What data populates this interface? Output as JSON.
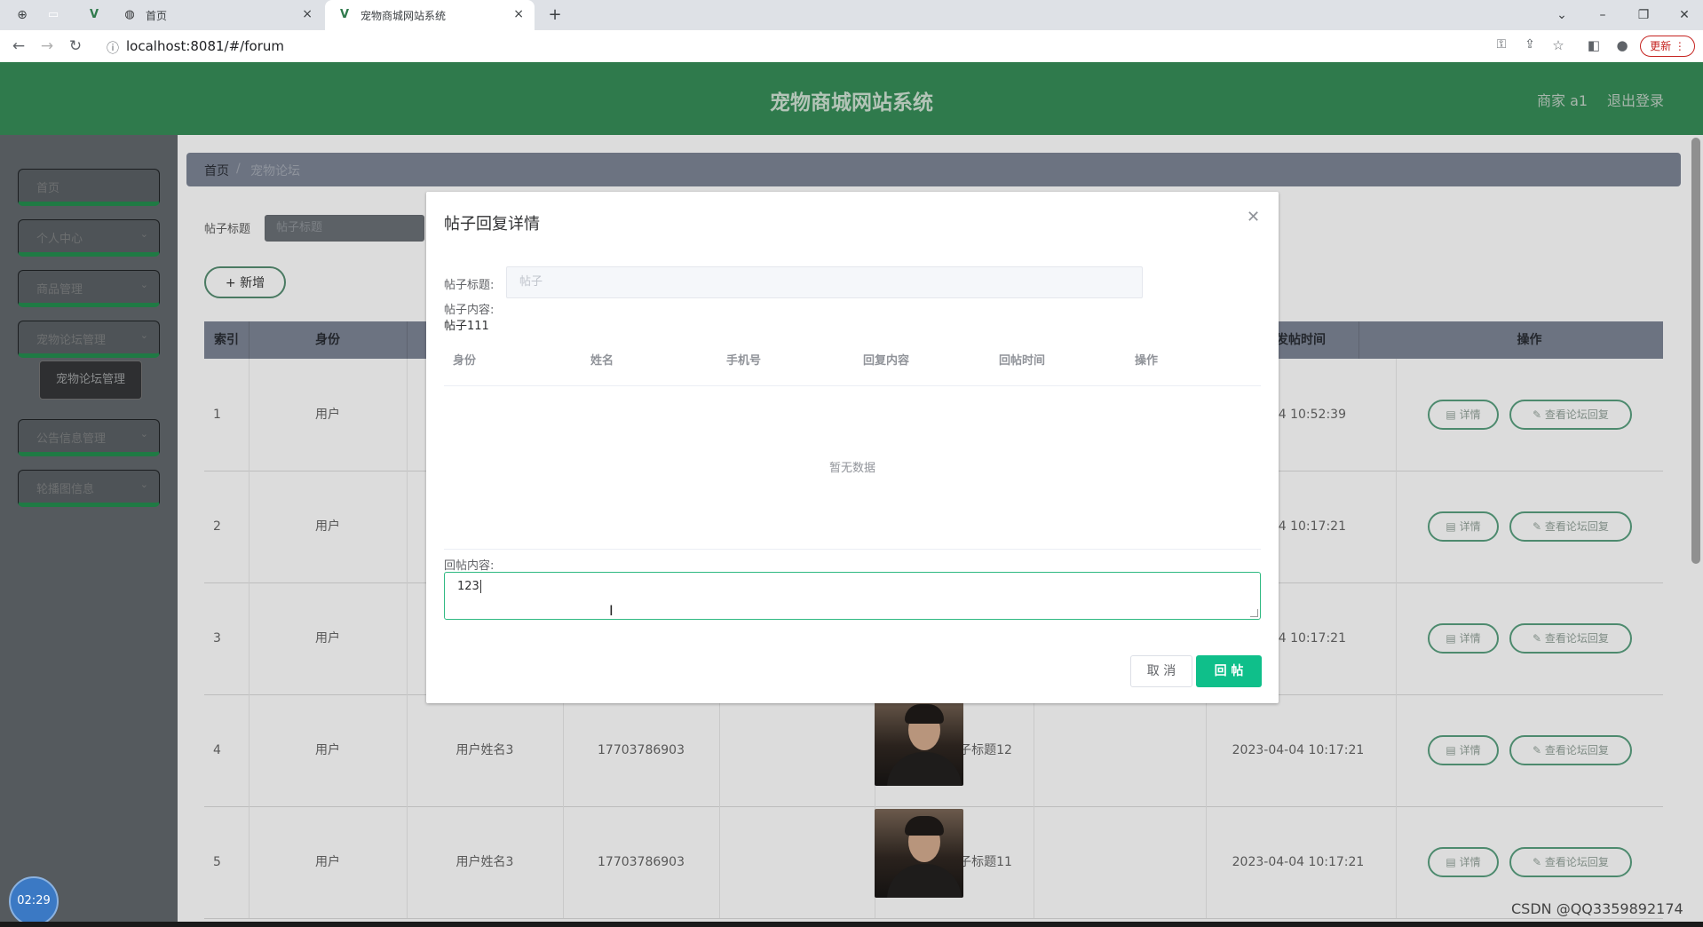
{
  "browser": {
    "tabs": [
      {
        "title": "",
        "icon": "blank-page-icon"
      },
      {
        "title": "",
        "icon": "vue-logo-icon"
      },
      {
        "title": "首页",
        "icon": "globe-icon"
      },
      {
        "title": "宠物商城网站系统",
        "icon": "vue-logo-icon"
      }
    ],
    "url": "localhost:8081/#/forum",
    "update_label": "更新"
  },
  "header": {
    "title": "宠物商城网站系统",
    "user": "商家 a1",
    "logout": "退出登录"
  },
  "sidebar": {
    "items": [
      {
        "label": "首页"
      },
      {
        "label": "个人中心"
      },
      {
        "label": "商品管理"
      },
      {
        "label": "宠物论坛管理"
      },
      {
        "label": "公告信息管理"
      },
      {
        "label": "轮播图信息"
      }
    ],
    "submenu_label": "宠物论坛管理"
  },
  "timer": "02:29",
  "breadcrumb": {
    "home": "首页",
    "separator": "/",
    "current": "宠物论坛"
  },
  "search": {
    "label": "帖子标题",
    "placeholder": "帖子标题"
  },
  "add_button": "+ 新增",
  "table": {
    "headers": [
      "索引",
      "身份",
      "",
      "",
      "",
      "",
      "发帖时间",
      "操作"
    ],
    "rows": [
      {
        "index": "1",
        "role": "用户",
        "name": "",
        "phone": "",
        "title": "",
        "time": "04-04 10:52:39",
        "avatar": false
      },
      {
        "index": "2",
        "role": "用户",
        "name": "",
        "phone": "",
        "title": "",
        "time": "04-04 10:17:21",
        "avatar": false
      },
      {
        "index": "3",
        "role": "用户",
        "name": "",
        "phone": "",
        "title": "",
        "time": "04-04 10:17:21",
        "avatar": false
      },
      {
        "index": "4",
        "role": "用户",
        "name": "用户姓名3",
        "phone": "17703786903",
        "title": "帖子标题12",
        "time": "2023-04-04 10:17:21",
        "avatar": true
      },
      {
        "index": "5",
        "role": "用户",
        "name": "用户姓名3",
        "phone": "17703786903",
        "title": "帖子标题11",
        "time": "2023-04-04 10:17:21",
        "avatar": true
      }
    ],
    "detail_button": "详情",
    "reply_button": "查看论坛回复"
  },
  "dialog": {
    "title": "帖子回复详情",
    "post_title_label": "帖子标题:",
    "post_title_value": "帖子",
    "post_content_label": "帖子内容:",
    "post_content_value": "帖子111",
    "reply_headers": [
      "身份",
      "姓名",
      "手机号",
      "回复内容",
      "回帖时间",
      "操作"
    ],
    "empty_text": "暂无数据",
    "reply_label": "回帖内容:",
    "reply_value": "123",
    "cancel": "取 消",
    "submit": "回 帖"
  },
  "watermark": "CSDN @QQ3359892174",
  "colors": {
    "header_green": "#2f7a4c",
    "primary_button": "#0fbf8a",
    "sidebar_bg": "#555a5e"
  }
}
